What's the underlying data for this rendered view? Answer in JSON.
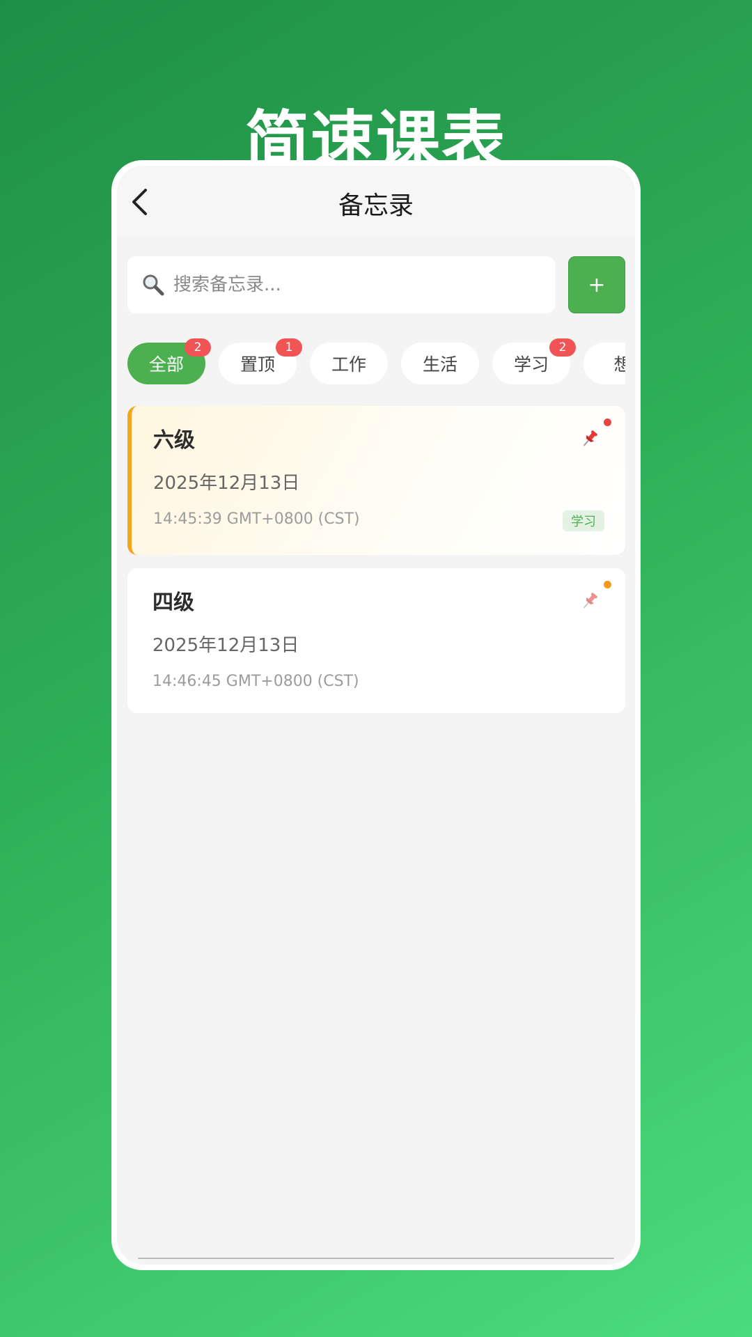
{
  "promo": {
    "title": "简速课表"
  },
  "header": {
    "title": "备忘录"
  },
  "search": {
    "placeholder": "搜索备忘录..."
  },
  "add_button": {
    "label": "+"
  },
  "categories": [
    {
      "label": "全部",
      "badge": "2",
      "active": true
    },
    {
      "label": "置顶",
      "badge": "1",
      "active": false
    },
    {
      "label": "工作",
      "badge": "",
      "active": false
    },
    {
      "label": "生活",
      "badge": "",
      "active": false
    },
    {
      "label": "学习",
      "badge": "2",
      "active": false
    },
    {
      "label": "想",
      "badge": "",
      "active": false
    }
  ],
  "notes": [
    {
      "title": "六级",
      "date": "2025年12月13日",
      "time": "14:45:39 GMT+0800 (CST)",
      "tag": "学习",
      "pinned": true,
      "dot_color": "#e8453c"
    },
    {
      "title": "四级",
      "date": "2025年12月13日",
      "time": "14:46:45 GMT+0800 (CST)",
      "tag": "",
      "pinned": false,
      "dot_color": "#f59a1b"
    }
  ],
  "colors": {
    "accent": "#4caf50",
    "badge": "#f05454",
    "pinned_border": "#f6a520"
  },
  "icons": {
    "back": "chevron-left-icon",
    "search": "magnifier-icon",
    "pin": "pushpin-icon"
  }
}
